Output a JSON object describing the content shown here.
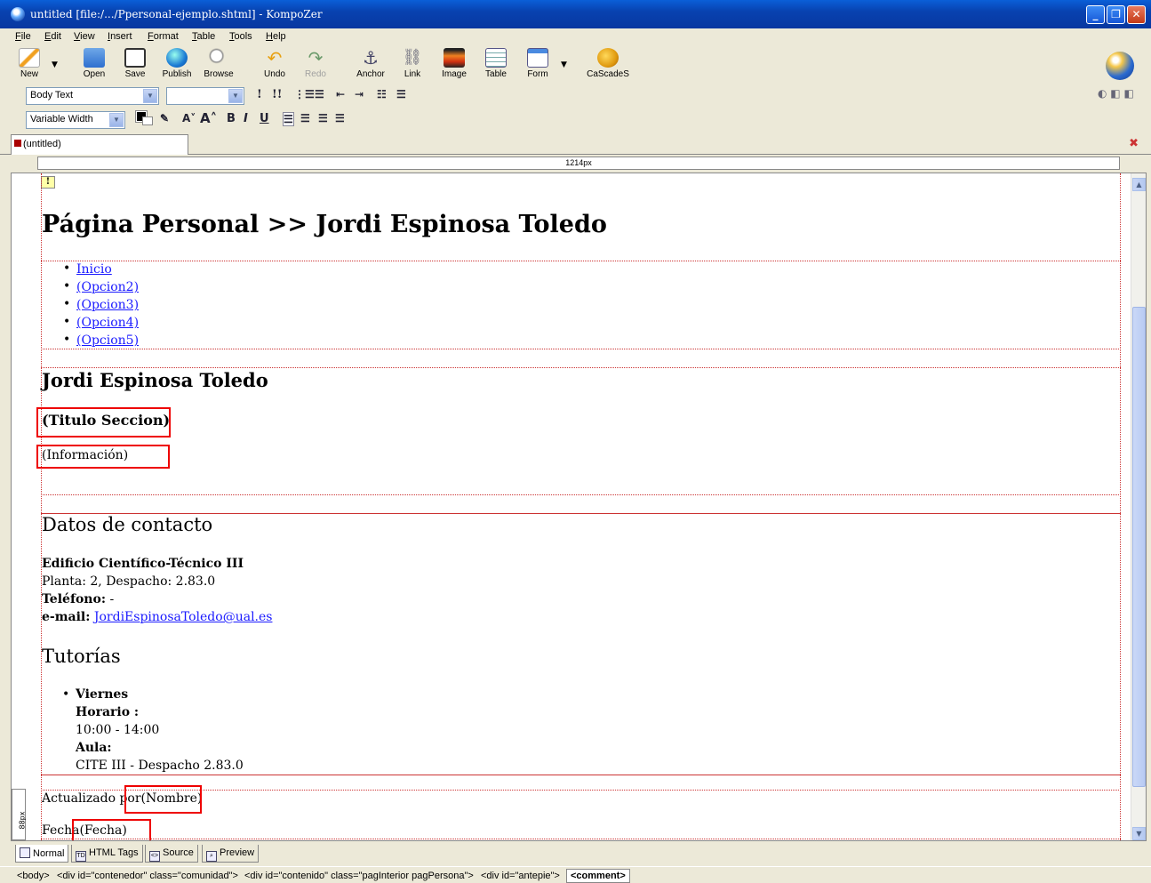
{
  "window": {
    "title": "untitled [file:/.../Ppersonal-ejemplo.shtml] - KompoZer"
  },
  "menu": [
    "File",
    "Edit",
    "View",
    "Insert",
    "Format",
    "Table",
    "Tools",
    "Help"
  ],
  "toolbar": {
    "new": "New",
    "open": "Open",
    "save": "Save",
    "publish": "Publish",
    "browse": "Browse",
    "undo": "Undo",
    "redo": "Redo",
    "anchor": "Anchor",
    "link": "Link",
    "image": "Image",
    "table": "Table",
    "form": "Form",
    "cascades": "CaScadeS"
  },
  "format1": {
    "paragraph_style": "Body Text",
    "font_size": ""
  },
  "format2": {
    "font": "Variable Width"
  },
  "tab": {
    "label": "(untitled)"
  },
  "ruler": {
    "width_label": "1214px"
  },
  "doc": {
    "page_title": "Página Personal >> Jordi Espinosa Toledo",
    "nav": [
      "Inicio",
      "(Opcion2)",
      "(Opcion3)",
      "(Opcion4)",
      "(Opcion5)"
    ],
    "name_heading": "Jordi Espinosa Toledo",
    "section_title": "(Titulo Seccion)",
    "section_info": "(Información)",
    "contact_heading": "Datos de contacto",
    "building": "Edificio Científico-Técnico III",
    "office": "Planta: 2, Despacho: 2.83.0",
    "phone_label": "Teléfono:",
    "phone_value": " -",
    "email_label": "e-mail:",
    "email_value": "JordiEspinosaToledo@ual.es",
    "tutoring_heading": "Tutorías",
    "tutoring": {
      "day": "Viernes",
      "schedule_label": "Horario :",
      "schedule": "10:00 - 14:00",
      "room_label": "Aula:",
      "room": "CITE III - Despacho 2.83.0"
    },
    "updated_by_label": "Actualizado por",
    "updated_by_value": "(Nombre)",
    "date_label": "Fecha",
    "date_value": "(Fecha)"
  },
  "side_indicator": "88px",
  "modes": [
    "Normal",
    "HTML Tags",
    "Source",
    "Preview"
  ],
  "status_crumbs": [
    "<body>",
    "<div id=\"contenedor\" class=\"comunidad\">",
    "<div id=\"contenido\" class=\"pagInterior pagPersona\">",
    "<div id=\"antepie\">",
    "<comment>"
  ]
}
